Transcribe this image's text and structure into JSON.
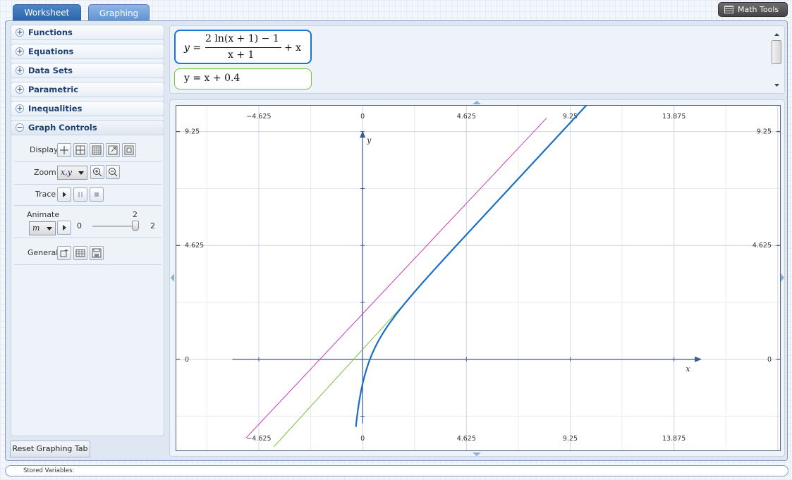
{
  "tabs": {
    "worksheet": "Worksheet",
    "graphing": "Graphing"
  },
  "math_tools": {
    "label": "Math Tools",
    "icon": "list-icon"
  },
  "sidebar": {
    "sections": [
      {
        "label": "Functions"
      },
      {
        "label": "Equations"
      },
      {
        "label": "Data Sets"
      },
      {
        "label": "Parametric"
      },
      {
        "label": "Inequalities"
      },
      {
        "label": "Graph Controls"
      }
    ],
    "controls": {
      "display_label": "Display",
      "zoom_label": "Zoom",
      "zoom_value": "x,y",
      "trace_label": "Trace",
      "animate_label": "Animate",
      "animate_variable": "m",
      "animate_min": "0",
      "animate_max": "2",
      "animate_current": "2",
      "general_label": "General"
    },
    "reset_button": "Reset Graphing Tab"
  },
  "formulas": {
    "f1": {
      "lhs": "y =",
      "numerator": "2 ln(x + 1) − 1",
      "denominator": "x + 1",
      "tail": "+ x"
    },
    "f2": {
      "text": "y = x + 0.4"
    }
  },
  "stored_variables": "Stored Variables:",
  "graph": {
    "colors": {
      "curve": "#1a6fc4",
      "line1": "#7ac143",
      "line2": "#c43fb8",
      "axes": "#3a5a9a"
    },
    "x_ticks": [
      "−4.625",
      "0",
      "4.625",
      "9.25",
      "13.875"
    ],
    "y_ticks": [
      "9.25",
      "4.625",
      "0"
    ],
    "x_axis_label": "x",
    "y_axis_label": "y"
  },
  "chart_data": {
    "type": "line",
    "title": "",
    "xlabel": "x",
    "ylabel": "y",
    "xlim": [
      -8.3,
      18.6
    ],
    "ylim": [
      -3.7,
      10.3
    ],
    "grid": true,
    "series": [
      {
        "name": "y = (2 ln(x + 1) − 1)/(x + 1) + x",
        "color": "#1a6fc4",
        "function": "curve",
        "domain": [
          -0.3,
          10.3
        ]
      },
      {
        "name": "y = x + 0.4",
        "color": "#7ac143",
        "function": "line_offset_0.4",
        "domain": [
          -3.95,
          1.75
        ]
      },
      {
        "name": "",
        "color": "#c43fb8",
        "points": [
          [
            -5.2,
            -3.2
          ],
          [
            8.2,
            9.8
          ]
        ]
      }
    ]
  }
}
